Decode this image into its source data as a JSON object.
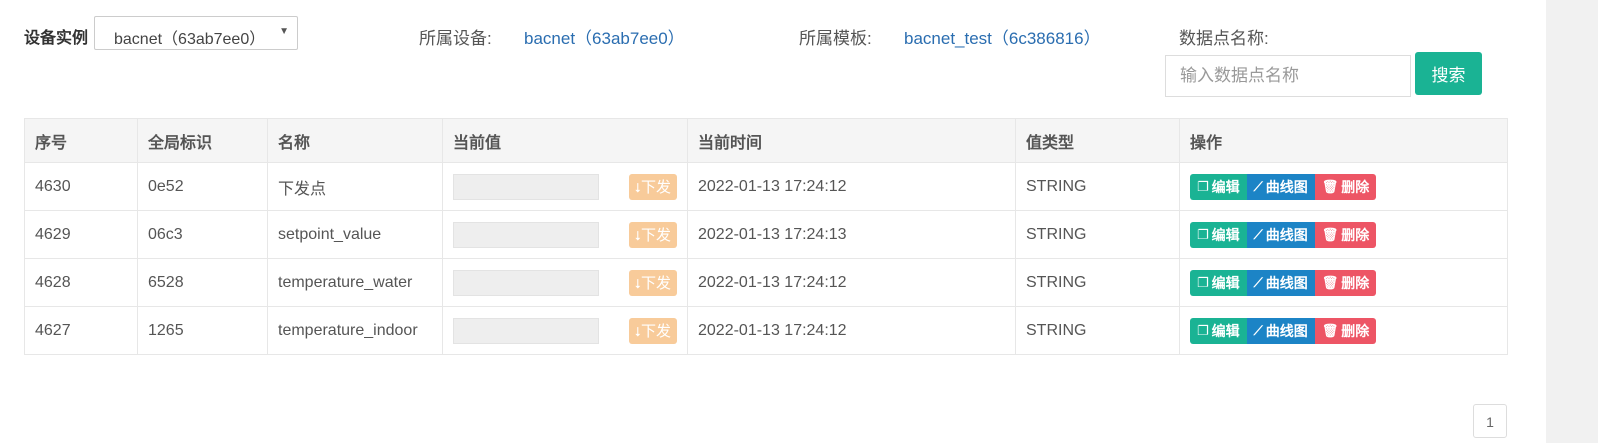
{
  "filters": {
    "instance_label": "设备实例",
    "instance_value": "bacnet（63ab7ee0）",
    "device_label": "所属设备:",
    "device_value": "bacnet（63ab7ee0）",
    "template_label": "所属模板:",
    "template_value": "bacnet_test（6c386816）",
    "point_name_label": "数据点名称:",
    "search_placeholder": "输入数据点名称",
    "search_button": "搜索"
  },
  "table": {
    "headers": [
      "序号",
      "全局标识",
      "名称",
      "当前值",
      "当前时间",
      "值类型",
      "操作"
    ],
    "rows": [
      {
        "id": "4630",
        "gid": "0e52",
        "name": "下发点",
        "value": "",
        "time": "2022-01-13 17:24:12",
        "type": "STRING"
      },
      {
        "id": "4629",
        "gid": "06c3",
        "name": "setpoint_value",
        "value": "",
        "time": "2022-01-13 17:24:13",
        "type": "STRING"
      },
      {
        "id": "4628",
        "gid": "6528",
        "name": "temperature_water",
        "value": "",
        "time": "2022-01-13 17:24:12",
        "type": "STRING"
      },
      {
        "id": "4627",
        "gid": "1265",
        "name": "temperature_indoor",
        "value": "",
        "time": "2022-01-13 17:24:12",
        "type": "STRING"
      }
    ],
    "send_label": "下发",
    "actions": {
      "edit": "编辑",
      "chart": "曲线图",
      "delete": "删除"
    }
  },
  "pagination": {
    "current": "1"
  },
  "colors": {
    "primary": "#1ab394",
    "info": "#1c84c6",
    "danger": "#ed5565",
    "warning_light": "#f8cb9a",
    "link": "#2a6db0"
  },
  "icons": {
    "send": "arrow-down-icon",
    "edit": "copy-icon",
    "chart": "line-chart-icon",
    "delete": "trash-icon",
    "select": "caret-down-icon"
  }
}
